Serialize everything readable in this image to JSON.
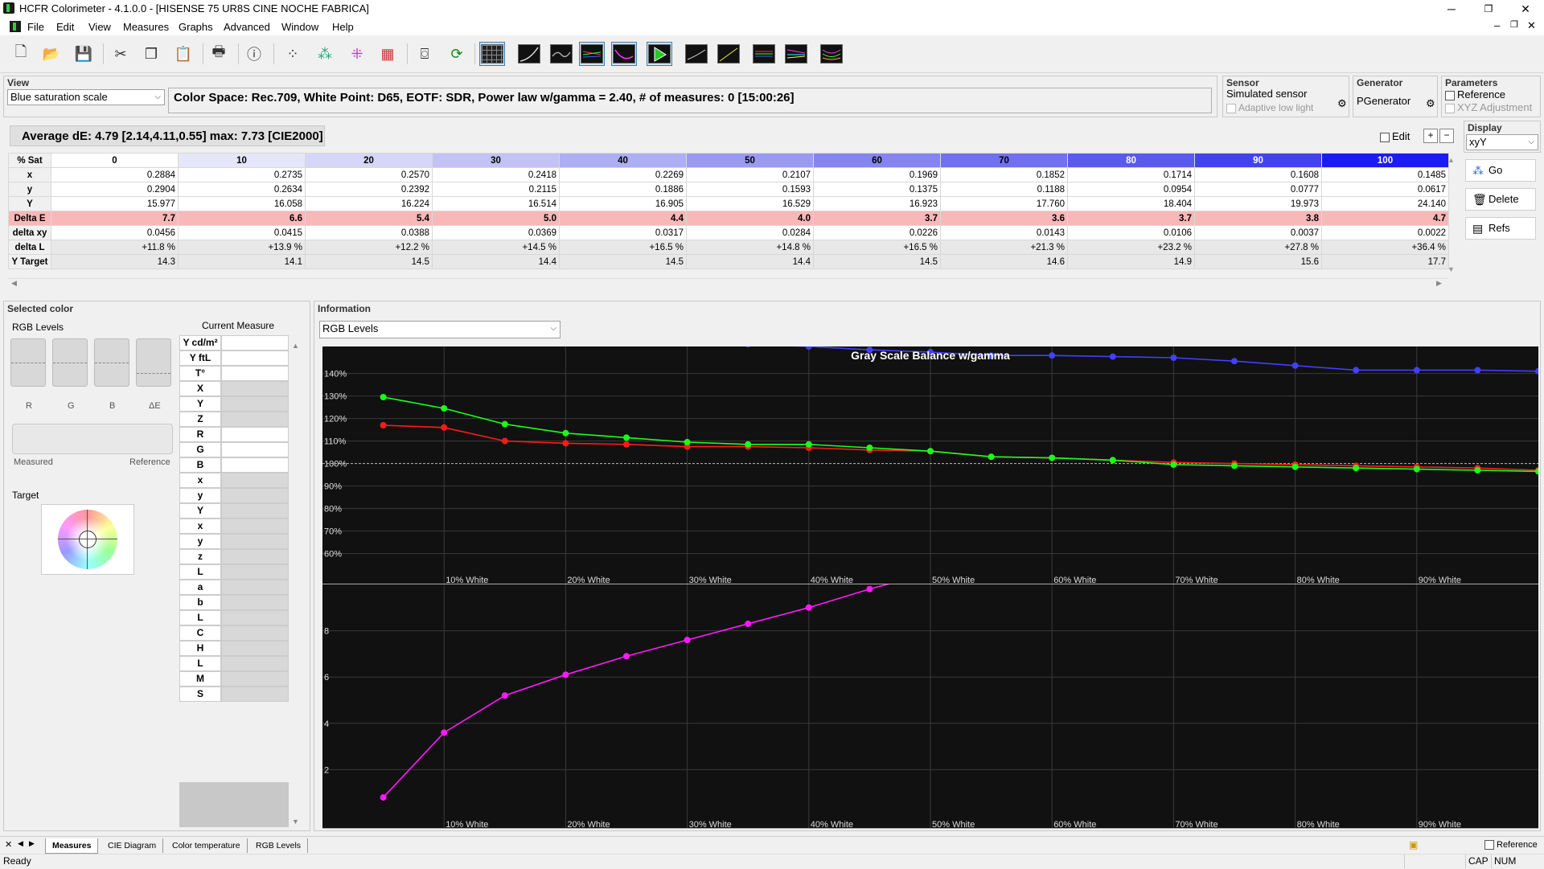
{
  "window": {
    "title": "HCFR Colorimeter - 4.1.0.0 - [HISENSE 75 UR8S CINE NOCHE FABRICA]",
    "minimize": "─",
    "maximize": "❐",
    "close": "✕"
  },
  "menu": [
    "File",
    "Edit",
    "View",
    "Measures",
    "Graphs",
    "Advanced",
    "Window",
    "Help"
  ],
  "mdi_controls": [
    "–",
    "❐",
    "✕"
  ],
  "view_panel": {
    "label": "View",
    "selected": "Blue saturation scale",
    "info": "Color Space: Rec.709, White Point: D65, EOTF:  SDR, Power law w/gamma = 2.40, # of measures: 0 [15:00:26]"
  },
  "sensor_panel": {
    "label": "Sensor",
    "name": "Simulated sensor",
    "adaptive_label": "Adaptive low light"
  },
  "generator_panel": {
    "label": "Generator",
    "name": "PGenerator"
  },
  "parameters_panel": {
    "label": "Parameters",
    "reference": "Reference",
    "xyz_adjust": "XYZ Adjustment"
  },
  "display_panel": {
    "label": "Display",
    "selected": "xyY"
  },
  "avg_de": "Average dE: 4.79 [2.14,4.11,0.55] max: 7.73 [CIE2000]",
  "edit_label": "Edit",
  "plus": "+",
  "minus": "−",
  "side_buttons": {
    "go": "Go",
    "delete": "Delete",
    "refs": "Refs"
  },
  "table": {
    "corner": "% Sat",
    "columns": [
      "0",
      "10",
      "20",
      "30",
      "40",
      "50",
      "60",
      "70",
      "80",
      "90",
      "100"
    ],
    "header_colors": [
      "#ffffff",
      "#e6e6fa",
      "#d6d6f8",
      "#c2c2f6",
      "#aeaef5",
      "#9a9af3",
      "#8585f2",
      "#7070f0",
      "#5a5af0",
      "#4343ee",
      "#1c1cf0"
    ],
    "rows": [
      {
        "label": "x",
        "values": [
          "0.2884",
          "0.2735",
          "0.2570",
          "0.2418",
          "0.2269",
          "0.2107",
          "0.1969",
          "0.1852",
          "0.1714",
          "0.1608",
          "0.1485"
        ]
      },
      {
        "label": "y",
        "values": [
          "0.2904",
          "0.2634",
          "0.2392",
          "0.2115",
          "0.1886",
          "0.1593",
          "0.1375",
          "0.1188",
          "0.0954",
          "0.0777",
          "0.0617"
        ]
      },
      {
        "label": "Y",
        "values": [
          "15.977",
          "16.058",
          "16.224",
          "16.514",
          "16.905",
          "16.529",
          "16.923",
          "17.760",
          "18.404",
          "19.973",
          "24.140"
        ]
      },
      {
        "label": "Delta E",
        "values": [
          "7.7",
          "6.6",
          "5.4",
          "5.0",
          "4.4",
          "4.0",
          "3.7",
          "3.6",
          "3.7",
          "3.8",
          "4.7"
        ]
      },
      {
        "label": "delta xy",
        "values": [
          "0.0456",
          "0.0415",
          "0.0388",
          "0.0369",
          "0.0317",
          "0.0284",
          "0.0226",
          "0.0143",
          "0.0106",
          "0.0037",
          "0.0022"
        ]
      },
      {
        "label": "delta L",
        "values": [
          "+11.8 %",
          "+13.9 %",
          "+12.2 %",
          "+14.5 %",
          "+16.5 %",
          "+14.8 %",
          "+16.5 %",
          "+21.3 %",
          "+23.2 %",
          "+27.8 %",
          "+36.4 %"
        ]
      },
      {
        "label": "Y Target",
        "values": [
          "14.3",
          "14.1",
          "14.5",
          "14.4",
          "14.5",
          "14.4",
          "14.5",
          "14.6",
          "14.9",
          "15.6",
          "17.7"
        ]
      }
    ]
  },
  "selected_color": {
    "label": "Selected color",
    "rgb_levels": "RGB Levels",
    "channels": [
      "R",
      "G",
      "B",
      "ΔE"
    ],
    "measured": "Measured",
    "reference": "Reference",
    "target": "Target",
    "current_measure": "Current Measure",
    "measure_labels": [
      "Y cd/m²",
      "Y ftL",
      "T°",
      "X",
      "Y",
      "Z",
      "R",
      "G",
      "B",
      "x",
      "y",
      "Y",
      "x",
      "y",
      "z",
      "L",
      "a",
      "b",
      "L",
      "C",
      "H",
      "L",
      "M",
      "S"
    ]
  },
  "information": {
    "label": "Information",
    "selected": "RGB Levels",
    "x_labels": [
      "10% White",
      "20% White",
      "30% White",
      "40% White",
      "50% White",
      "60% White",
      "70% White",
      "80% White",
      "90% White"
    ]
  },
  "chart_data": [
    {
      "type": "line",
      "title": "Gray Scale Balance w/gamma",
      "ylim": [
        52,
        152
      ],
      "yticks": [
        "60%",
        "70%",
        "80%",
        "90%",
        "100%",
        "110%",
        "120%",
        "130%",
        "140%"
      ],
      "ytick_values": [
        60,
        70,
        80,
        90,
        100,
        110,
        120,
        130,
        140
      ],
      "x": [
        5,
        10,
        15,
        20,
        25,
        30,
        35,
        40,
        45,
        50,
        55,
        60,
        65,
        70,
        75,
        80,
        85,
        90,
        95,
        100
      ],
      "series": [
        {
          "color": "#ff1a1a",
          "values": [
            117,
            116,
            110,
            109,
            108.5,
            107.5,
            107.5,
            107,
            106,
            105.5,
            103,
            102.5,
            101.5,
            100.5,
            100,
            99.5,
            99,
            98.5,
            98,
            97
          ]
        },
        {
          "color": "#1aff1a",
          "values": [
            129.5,
            124.5,
            117.5,
            113.5,
            111.5,
            109.5,
            108.5,
            108.5,
            107,
            105.5,
            103,
            102.5,
            101.5,
            99.5,
            99,
            98.5,
            98,
            97.5,
            97,
            96.5
          ]
        },
        {
          "color": "#4040ff",
          "values": [
            158,
            157,
            156,
            155,
            155,
            154,
            153,
            152,
            150.5,
            149.5,
            148,
            148,
            147.5,
            147,
            145.5,
            143.5,
            141.5,
            141.5,
            141.5,
            141
          ]
        }
      ]
    },
    {
      "type": "line",
      "ylim": [
        0,
        10
      ],
      "yticks": [
        "2",
        "4",
        "6",
        "8"
      ],
      "ytick_values": [
        2,
        4,
        6,
        8
      ],
      "x": [
        5,
        10,
        15,
        20,
        25,
        30,
        35,
        40,
        45,
        50
      ],
      "series": [
        {
          "color": "#ff1aff",
          "values": [
            0.8,
            3.6,
            5.2,
            6.1,
            6.9,
            7.6,
            8.3,
            9.0,
            9.8,
            10.5
          ]
        }
      ]
    }
  ],
  "bottom_tabs": [
    "Measures",
    "CIE Diagram",
    "Color temperature",
    "RGB Levels"
  ],
  "tab_nav": [
    "✕",
    "◀",
    "▶"
  ],
  "status": {
    "ready": "Ready",
    "cap": "CAP",
    "num": "NUM",
    "reference": "Reference"
  }
}
